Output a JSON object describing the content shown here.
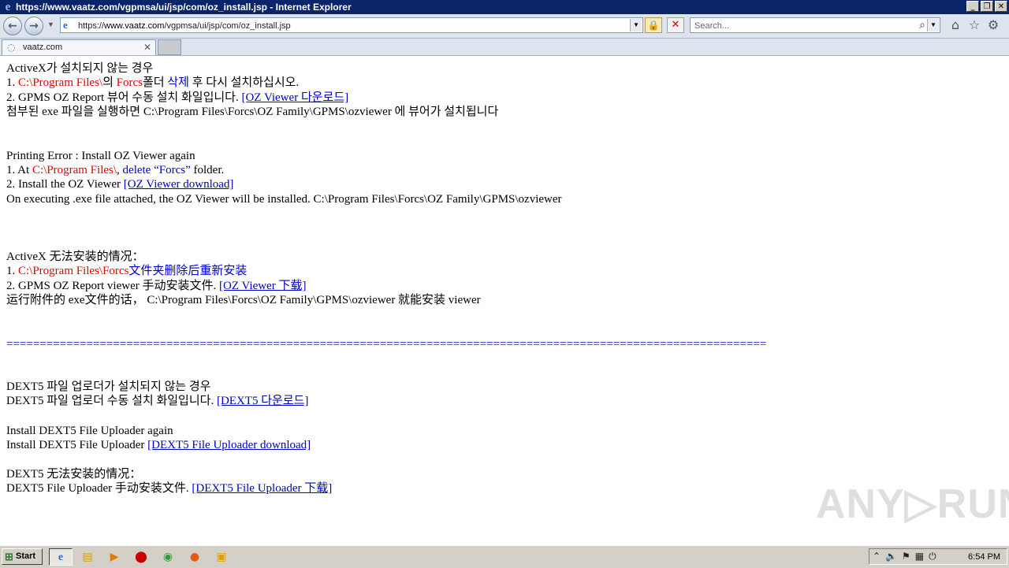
{
  "window": {
    "title": "https://www.vaatz.com/vgpmsa/ui/jsp/com/oz_install.jsp - Internet Explorer",
    "controls": {
      "minimize": "_",
      "restore": "❐",
      "close": "✕"
    }
  },
  "navbar": {
    "back": "←",
    "forward": "→",
    "url_prefix": "https://",
    "url_domain": "www.vaatz.com",
    "url_path": "/vgpmsa/ui/jsp/com/oz_install.jsp",
    "search_placeholder": "Search...",
    "icons": [
      "home-icon",
      "favorites-star-icon",
      "tools-gear-icon"
    ]
  },
  "tab": {
    "label": "vaatz.com"
  },
  "content": {
    "ko": {
      "heading": "ActiveX가 설치되지 않는 경우",
      "l1_num": "1. ",
      "l1_path": "C:\\Program Files\\",
      "l1_mid": "의 ",
      "l1_forcs": "Forcs",
      "l1_folder": "폴더 ",
      "l1_delete": "삭제",
      "l1_tail": " 후 다시 설치하십시오.",
      "l2_text": "2. GPMS OZ Report 뷰어 수동 설치 화일입니다. ",
      "l2_link": "[OZ Viewer 다운로드]",
      "l3": "첨부된 exe 파일을 실행하면 C:\\Program Files\\Forcs\\OZ Family\\GPMS\\ozviewer 에 뷰어가 설치됩니다"
    },
    "en": {
      "heading": "Printing Error : Install OZ Viewer again",
      "l1_num": "1. At ",
      "l1_path": "C:\\Program Files\\",
      "l1_comma": ", ",
      "l1_delete": "delete “Forcs”",
      "l1_tail": " folder.",
      "l2_text": "2. Install the OZ Viewer ",
      "l2_link": "[OZ Viewer download]",
      "l3": "On executing .exe file attached, the OZ Viewer will be installed. C:\\Program Files\\Forcs\\OZ Family\\GPMS\\ozviewer"
    },
    "zh": {
      "heading": "ActiveX 无法安装的情况：",
      "l1_num": "1. ",
      "l1_path": "C:\\Program Files\\Forcs",
      "l1_tail": "文件夹删除后重新安装",
      "l2_text": "2. GPMS OZ Report viewer 手动安装文件. ",
      "l2_link": "[OZ Viewer 下载]",
      "l3": "运行附件的 exe文件的话， C:\\Program Files\\Forcs\\OZ Family\\GPMS\\ozviewer 就能安装 viewer"
    },
    "separator": "==================================================================================================================",
    "dext_ko": {
      "heading": "DEXT5 파일 업로더가 설치되지 않는 경우",
      "l1_text": "DEXT5 파일 업로더 수동 설치 화일입니다. ",
      "l1_link": "[DEXT5 다운로드]"
    },
    "dext_en": {
      "heading": "Install DEXT5 File Uploader again",
      "l1_text": "Install DEXT5 File Uploader ",
      "l1_link": "[DEXT5 File Uploader download]"
    },
    "dext_zh": {
      "heading": "DEXT5 无法安装的情况：",
      "l1_text": "DEXT5 File Uploader 手动安装文件. ",
      "l1_link": "[DEXT5 File Uploader 下载]"
    }
  },
  "watermark": {
    "text": "ANY▷RUN"
  },
  "taskbar": {
    "start_label": "Start",
    "clock": "6:54 PM",
    "apps": [
      "internet-explorer-icon",
      "file-explorer-icon",
      "media-player-icon",
      "opera-icon",
      "chrome-icon",
      "firefox-icon",
      "outlook-icon"
    ]
  },
  "colors": {
    "path_red": "#e60000",
    "link_blue": "#0000c8",
    "title_bar": "#0a246a"
  }
}
